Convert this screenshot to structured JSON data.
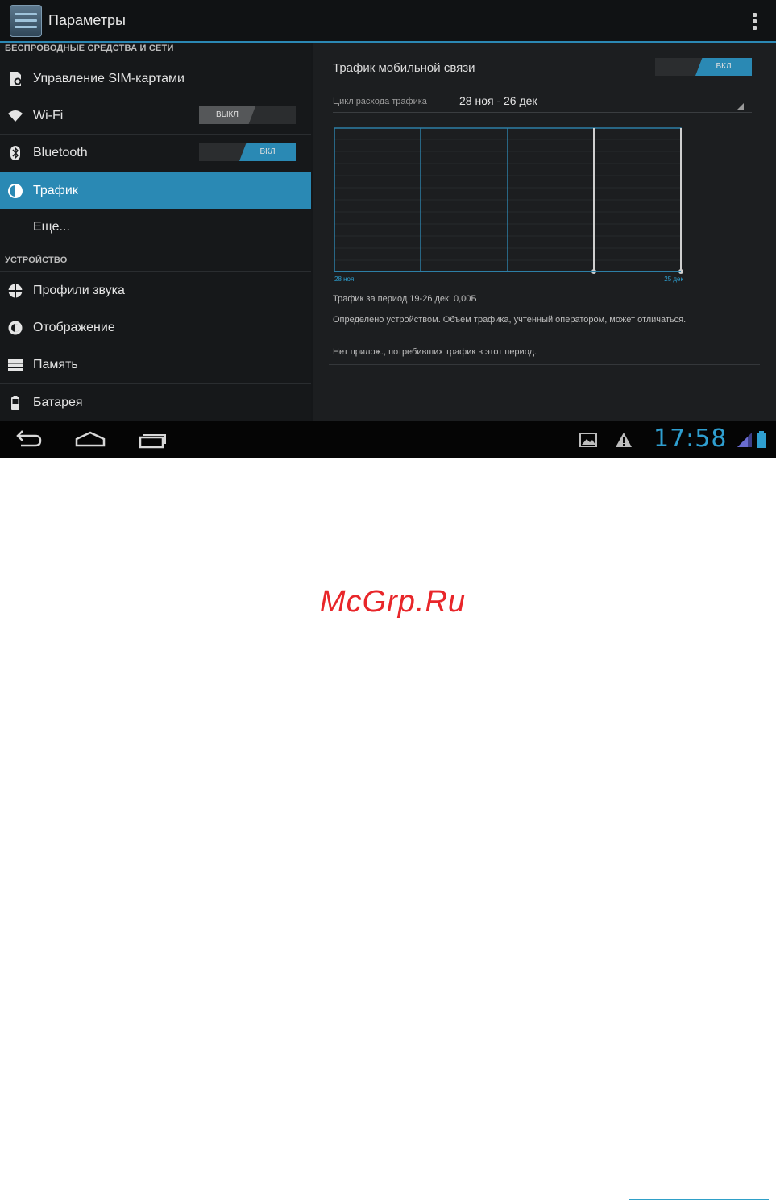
{
  "action_bar": {
    "title": "Параметры"
  },
  "settings": {
    "wireless_header": "БЕСПРОВОДНЫЕ СРЕДСТВА И СЕТИ",
    "sim_label": "Управление SIM-картами",
    "wifi_label": "Wi-Fi",
    "wifi_toggle": "ВЫКЛ",
    "bluetooth_label": "Bluetooth",
    "bluetooth_toggle": "ВКЛ",
    "traffic_label": "Трафик",
    "more_label": "Еще...",
    "device_header": "УСТРОЙСТВО",
    "sound_label": "Профили звука",
    "display_label": "Отображение",
    "storage_label": "Память",
    "battery_label": "Батарея"
  },
  "traffic": {
    "mobile_title": "Трафик мобильной связи",
    "mobile_toggle": "ВКЛ",
    "cycle_label": "Цикл расхода трафика",
    "cycle_value": "28 ноя - 26 дек",
    "summary": "Трафик за период 19-26 дек: 0,00Б",
    "note": "Определено устройством. Объем трафика, учтенный оператором, может отличаться.",
    "no_apps": "Нет прилож., потребивших трафик в этот период."
  },
  "chart_data": {
    "type": "line",
    "x_start_label": "28 ноя",
    "x_end_label": "25 дек",
    "values": [
      0
    ]
  },
  "nav_bar": {
    "clock": "17:58"
  },
  "watermark": "McGrp.Ru",
  "colors": {
    "accent": "#2a89b4",
    "clock": "#2f9fd0",
    "watermark": "#e8262a",
    "background": "#151719"
  },
  "icons": [
    "settings-app-icon",
    "overflow-menu-icon",
    "sim-icon",
    "wifi-icon",
    "bluetooth-icon",
    "traffic-icon",
    "sound-icon",
    "display-icon",
    "storage-icon",
    "battery-icon",
    "back-icon",
    "home-icon",
    "recents-icon",
    "gallery-icon",
    "warning-icon",
    "signal-icon",
    "battery-status-icon"
  ]
}
